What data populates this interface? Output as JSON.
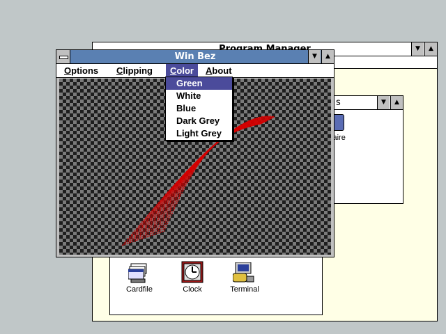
{
  "program_manager": {
    "title": "Program Manager",
    "icons": [
      {
        "label": "Cardfile",
        "icon": "cardfile-icon"
      },
      {
        "label": "Clock",
        "icon": "clock-icon"
      },
      {
        "label": "Terminal",
        "icon": "terminal-icon"
      }
    ],
    "games_group": {
      "title_fragment": "s",
      "icon_label_fragment": "itaire"
    }
  },
  "winbez": {
    "title": "Win Bez",
    "menu": {
      "options": "Options",
      "clipping": "Clipping",
      "color": "Color",
      "about": "About"
    },
    "color_menu_items": [
      "Green",
      "White",
      "Blue",
      "Dark Grey",
      "Light Grey"
    ],
    "selected_color_item": "Green",
    "curve_color": "#d40000"
  },
  "colors": {
    "desktop": "#c0c7c8",
    "active_title": "#5a80b2",
    "menu_highlight": "#4b4b9b",
    "group_bg": "#ffffe6"
  }
}
